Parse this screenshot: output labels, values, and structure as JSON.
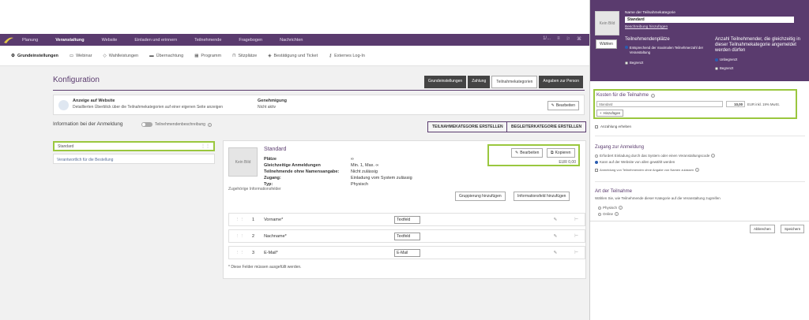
{
  "topnav": {
    "items": [
      "Planung",
      "Veranstaltung",
      "Website",
      "Einladen und erinnern",
      "Teilnehmende",
      "Fragebogen",
      "Nachrichten"
    ],
    "active_index": 1,
    "right": [
      "1/...",
      "≡",
      "⚐",
      "⌘"
    ]
  },
  "subnav": {
    "items": [
      "Grundeinstellungen",
      "Webinar",
      "Wahlleistungen",
      "Übernachtung",
      "Programm",
      "Sitzplätze",
      "Bestätigung und Ticket",
      "Externes Log-In"
    ]
  },
  "page": {
    "title": "Konfiguration",
    "tabs": [
      "Grundeinstellungen",
      "Zahlung",
      "Teilnahmekategorien",
      "Angaben zur Person"
    ],
    "active_tab": 2
  },
  "website_card": {
    "heading": "Anzeige auf Website",
    "text": "Detaillierten Überblick über die Teilnahmekategorien auf einer eigenen Seite anzeigen",
    "approval_label": "Genehmigung",
    "approval_value": "Nicht aktiv",
    "edit_button": "Bearbeiten"
  },
  "registration": {
    "label": "Information bei der Anmeldung",
    "toggle_label": "Teilnehmendenbeschreibung",
    "btn_category": "TEILNAHMEKATEGORIE ERSTELLEN",
    "btn_companion": "BEGLEITERKATEGORIE ERSTELLEN"
  },
  "category_list": {
    "selected": "Standard",
    "responsible": "Verantwortlich für die Bestellung"
  },
  "category_detail": {
    "image_label": "Kein Bild",
    "name": "Standard",
    "edit_button": "Bearbeiten",
    "copy_button": "Kopieren",
    "price": "EUR 0,00",
    "props": [
      {
        "k": "Plätze",
        "v": "∞"
      },
      {
        "k": "Gleichzeitige Anmeldungen",
        "v": "Min. 1, Max. ∞"
      },
      {
        "k": "Teilnehmende ohne Namensangabe:",
        "v": "Nicht zulässig"
      },
      {
        "k": "Zugang:",
        "v": "Einladung vom System zulässig"
      },
      {
        "k": "Typ:",
        "v": "Physisch"
      }
    ],
    "fields_label": "Zugehörige Informationsfelder",
    "btn_group": "Gruppierung hinzufügen",
    "btn_field": "Informationsfeld hinzufügen",
    "fields": [
      {
        "num": "1",
        "name": "Vorname*",
        "type": "Textfeld"
      },
      {
        "num": "2",
        "name": "Nachname*",
        "type": "Textfeld"
      },
      {
        "num": "3",
        "name": "E-Mail*",
        "type": "E-Mail"
      }
    ],
    "required_note": "* Diese Felder müssen ausgefüllt werden."
  },
  "panel": {
    "image_label": "Kein Bild",
    "choose_button": "Wählen",
    "name_label": "Name der Teilnahmekategorie",
    "name_value": "Standard",
    "add_desc": "Beschreibung hinzufügen",
    "seats_title": "Teilnehmendenplätze",
    "seats_opt1": "Entsprechend der maximalen Teilnehmerzahl der Veranstaltung",
    "seats_opt2": "Begrenzt",
    "simul_title": "Anzahl Teilnehmender, die gleichzeitig in dieser Teilnahmekategorie angemeldet werden dürfen",
    "simul_opt1": "Unbegrenzt",
    "simul_opt2": "Begrenzt",
    "cost_title": "Kosten für die Teilnahme",
    "cost_name": "Standard",
    "cost_amount": "10,00",
    "cost_suffix": "EUR inkl. 19% MwSt.",
    "cost_add": "Hinzufügen",
    "deposit": "Anzahlung erheben",
    "access_title": "Zugang zur Anmeldung",
    "access_opt1": "Erfordert Einladung durch das System oder einen Veranstaltungscode",
    "access_opt2": "Kann auf der Website von allen gewählt werden",
    "access_cb": "Anmeldung von Teilnehmenden ohne Angabe von Namen zulassen",
    "type_title": "Art der Teilnahme",
    "type_desc": "Wählen Sie, wie Teilnehmende dieser Kategorie auf die Veranstaltung zugreifen",
    "type_opt1": "Physisch",
    "type_opt2": "Online",
    "cancel": "Abbrechen",
    "save": "Speichern"
  },
  "colors": {
    "brand": "#5a3b6e",
    "highlight": "#9ac73e"
  }
}
